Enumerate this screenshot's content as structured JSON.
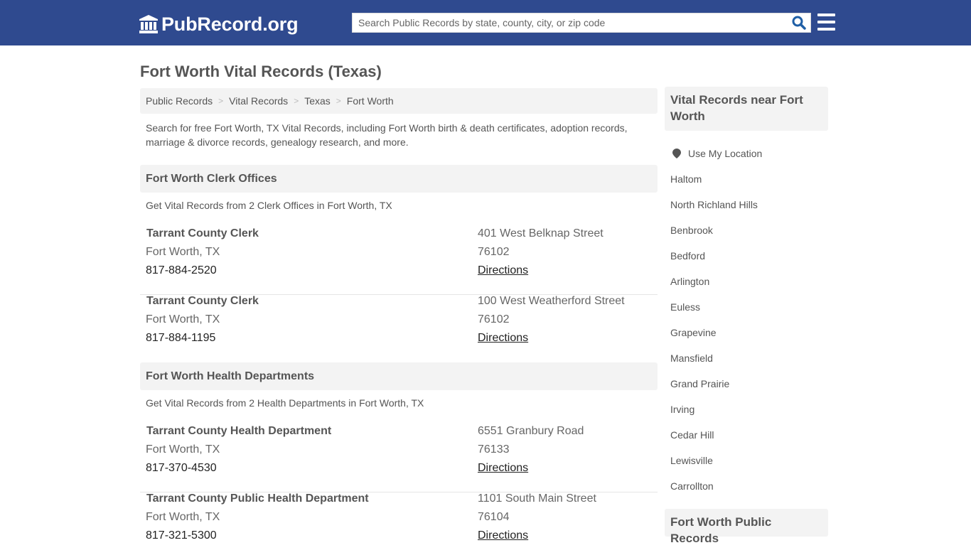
{
  "header": {
    "logo_text": "PubRecord.org",
    "search_placeholder": "Search Public Records by state, county, city, or zip code",
    "search_value": "",
    "brand_color": "#2f4a8f",
    "search_icon_color": "#1f5fa6"
  },
  "page": {
    "title": "Fort Worth Vital Records (Texas)",
    "breadcrumb": [
      "Public Records",
      "Vital Records",
      "Texas",
      "Fort Worth"
    ],
    "intro": "Search for free Fort Worth, TX Vital Records, including Fort Worth birth & death certificates, adoption records, marriage & divorce records, genealogy research, and more."
  },
  "sections": [
    {
      "title": "Fort Worth Clerk Offices",
      "subtitle": "Get Vital Records from 2 Clerk Offices in Fort Worth, TX",
      "records": [
        {
          "name": "Tarrant County Clerk",
          "city": "Fort Worth, TX",
          "phone": "817-884-2520",
          "street": "401 West Belknap Street",
          "zip": "76102",
          "directions": "Directions"
        },
        {
          "name": "Tarrant County Clerk",
          "city": "Fort Worth, TX",
          "phone": "817-884-1195",
          "street": "100 West Weatherford Street",
          "zip": "76102",
          "directions": "Directions"
        }
      ]
    },
    {
      "title": "Fort Worth Health Departments",
      "subtitle": "Get Vital Records from 2 Health Departments in Fort Worth, TX",
      "records": [
        {
          "name": "Tarrant County Health Department",
          "city": "Fort Worth, TX",
          "phone": "817-370-4530",
          "street": "6551 Granbury Road",
          "zip": "76133",
          "directions": "Directions"
        },
        {
          "name": "Tarrant County Public Health Department",
          "city": "Fort Worth, TX",
          "phone": "817-321-5300",
          "street": "1101 South Main Street",
          "zip": "76104",
          "directions": "Directions"
        }
      ]
    }
  ],
  "sidebar": {
    "nearby_title": "Vital Records near Fort Worth",
    "use_location": "Use My Location",
    "nearby": [
      "Haltom",
      "North Richland Hills",
      "Benbrook",
      "Bedford",
      "Arlington",
      "Euless",
      "Grapevine",
      "Mansfield",
      "Grand Prairie",
      "Irving",
      "Cedar Hill",
      "Lewisville",
      "Carrollton"
    ],
    "public_records_title": "Fort Worth Public Records"
  }
}
